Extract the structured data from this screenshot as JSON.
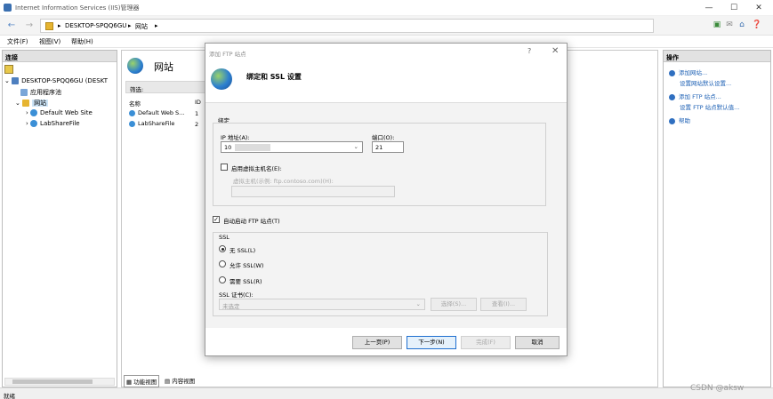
{
  "window": {
    "title": "Internet Information Services (IIS)管理器",
    "minimize": "—",
    "maximize": "☐",
    "close": "✕"
  },
  "address": {
    "path": [
      "DESKTOP-SPQQ6GU",
      "网站"
    ],
    "sep": "▸"
  },
  "menu": [
    "文件(F)",
    "视图(V)",
    "帮助(H)"
  ],
  "left_panel": {
    "header": "连接",
    "tree": [
      {
        "label": "DESKTOP-SPQQ6GU (DESKT",
        "level": 0,
        "expander": "⌄"
      },
      {
        "label": "应用程序池",
        "level": 1,
        "expander": ""
      },
      {
        "label": "网站",
        "level": 1,
        "expander": "⌄"
      },
      {
        "label": "Default Web Site",
        "level": 2,
        "expander": "›"
      },
      {
        "label": "LabShareFile",
        "level": 2,
        "expander": "›"
      }
    ]
  },
  "center": {
    "title": "网站",
    "filter_label": "筛选:",
    "columns": [
      "名称",
      "ID"
    ],
    "rows": [
      {
        "name": "Default Web S...",
        "id": "1"
      },
      {
        "name": "LabShareFile",
        "id": "2"
      }
    ],
    "tabs": [
      "功能视图",
      "内容视图"
    ]
  },
  "right_panel": {
    "header": "操作",
    "actions": [
      {
        "label": "添加网站...",
        "sub": false
      },
      {
        "label": "设置网站默认设置...",
        "sub": true
      },
      {
        "label": "添加 FTP 站点...",
        "sub": false
      },
      {
        "label": "设置 FTP 站点默认值...",
        "sub": true
      },
      {
        "label": "帮助",
        "sub": false
      }
    ]
  },
  "status": "就绪",
  "watermark": "CSDN @aksw",
  "dialog": {
    "title": "添加 FTP 站点",
    "help": "?",
    "close": "✕",
    "heading": "绑定和 SSL 设置",
    "binding_label": "绑定",
    "ip_label": "IP 地址(A):",
    "ip_value": "10",
    "port_label": "端口(O):",
    "port_value": "21",
    "virtual_host_checkbox": "启用虚拟主机名(E):",
    "virtual_host_label": "虚拟主机(示例: ftp.contoso.com)(H):",
    "autostart_checkbox": "自动启动 FTP 站点(T)",
    "ssl_label": "SSL",
    "ssl_options": [
      "无 SSL(L)",
      "允许 SSL(W)",
      "需要 SSL(R)"
    ],
    "ssl_selected": 0,
    "cert_label": "SSL 证书(C):",
    "cert_value": "未选定",
    "select_btn": "选择(S)...",
    "view_btn": "查看(I)...",
    "prev_btn": "上一页(P)",
    "next_btn": "下一步(N)",
    "finish_btn": "完成(F)",
    "cancel_btn": "取消"
  }
}
